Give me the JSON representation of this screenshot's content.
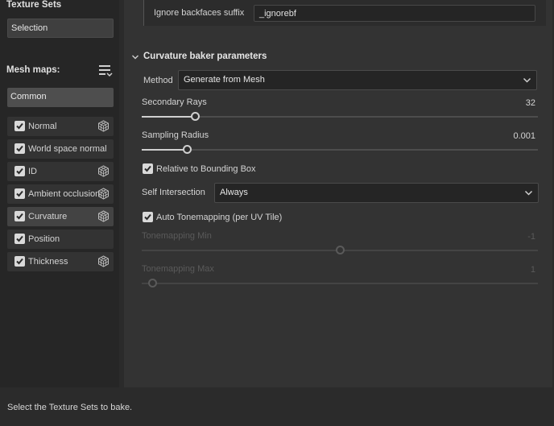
{
  "texture_sets": {
    "title": "Texture Sets",
    "selection": "Selection"
  },
  "mesh_maps": {
    "title": "Mesh maps:",
    "common": "Common",
    "items": [
      {
        "label": "Normal",
        "checked": true,
        "has_cube": true
      },
      {
        "label": "World space normal",
        "checked": true,
        "has_cube": false
      },
      {
        "label": "ID",
        "checked": true,
        "has_cube": true
      },
      {
        "label": "Ambient occlusion",
        "checked": true,
        "has_cube": true
      },
      {
        "label": "Curvature",
        "checked": true,
        "has_cube": true,
        "active": true
      },
      {
        "label": "Position",
        "checked": true,
        "has_cube": false
      },
      {
        "label": "Thickness",
        "checked": true,
        "has_cube": true
      }
    ]
  },
  "top": {
    "ignore_label": "Ignore backfaces suffix",
    "ignore_value": "_ignorebf"
  },
  "curvature": {
    "title": "Curvature baker parameters",
    "method_label": "Method",
    "method_value": "Generate from Mesh",
    "secondary_rays": {
      "label": "Secondary Rays",
      "value": "32",
      "fraction": 0.24
    },
    "sampling_radius": {
      "label": "Sampling Radius",
      "value": "0.001",
      "fraction": 0.12
    },
    "relative_bbox": {
      "label": "Relative to Bounding Box",
      "checked": true
    },
    "self_intersection": {
      "label": "Self Intersection",
      "value": "Always"
    },
    "auto_tonemapping": {
      "label": "Auto Tonemapping (per UV Tile)",
      "checked": true
    },
    "tonemapping_min": {
      "label": "Tonemapping Min",
      "value": "-1",
      "fraction": 0.5
    },
    "tonemapping_max": {
      "label": "Tonemapping Max",
      "value": "1",
      "fraction": 0.02
    }
  },
  "status": "Select the Texture Sets to bake."
}
